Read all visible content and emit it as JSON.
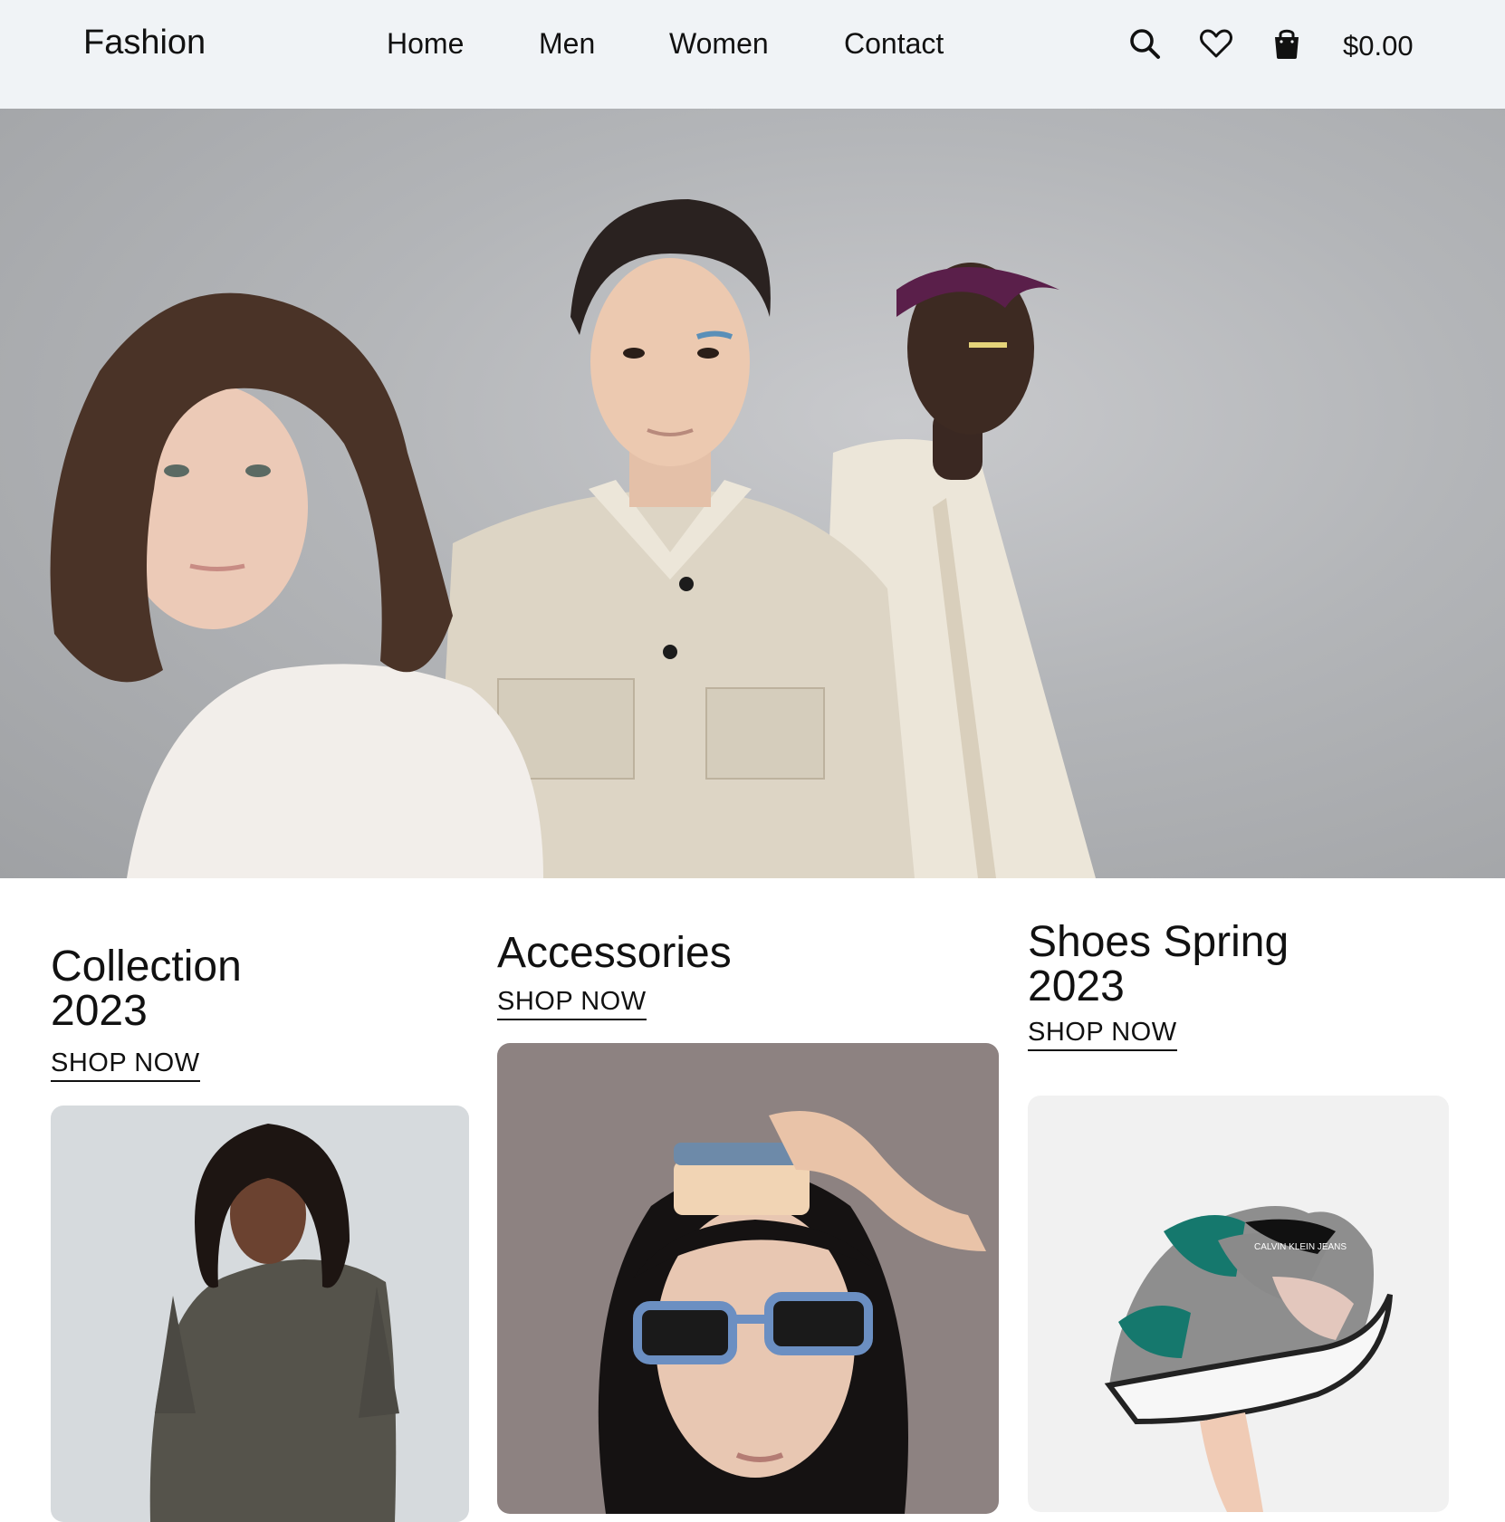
{
  "header": {
    "logo": "Fashion",
    "nav": [
      {
        "label": "Home"
      },
      {
        "label": "Men"
      },
      {
        "label": "Women"
      },
      {
        "label": "Contact"
      }
    ],
    "icons": [
      "search-icon",
      "heart-icon",
      "bag-icon"
    ],
    "cart_total": "$0.00"
  },
  "hero": {
    "image": "three-models-in-neutral-shirts"
  },
  "cards": [
    {
      "title_line1": "Collection",
      "title_line2": "2023",
      "cta": "SHOP NOW",
      "image": "woman-in-olive-tshirt"
    },
    {
      "title_line1": "Accessories",
      "title_line2": "",
      "cta": "SHOP NOW",
      "image": "woman-with-blue-sunglasses"
    },
    {
      "title_line1": "Shoes Spring",
      "title_line2": "2023",
      "cta": "SHOP NOW",
      "image": "hand-holding-sneaker"
    }
  ],
  "sneaker_brand": "CALVIN KLEIN JEANS",
  "colors": {
    "header_bg": "#f0f3f6",
    "text": "#111111",
    "hero_bg": "#b3b5b8"
  }
}
